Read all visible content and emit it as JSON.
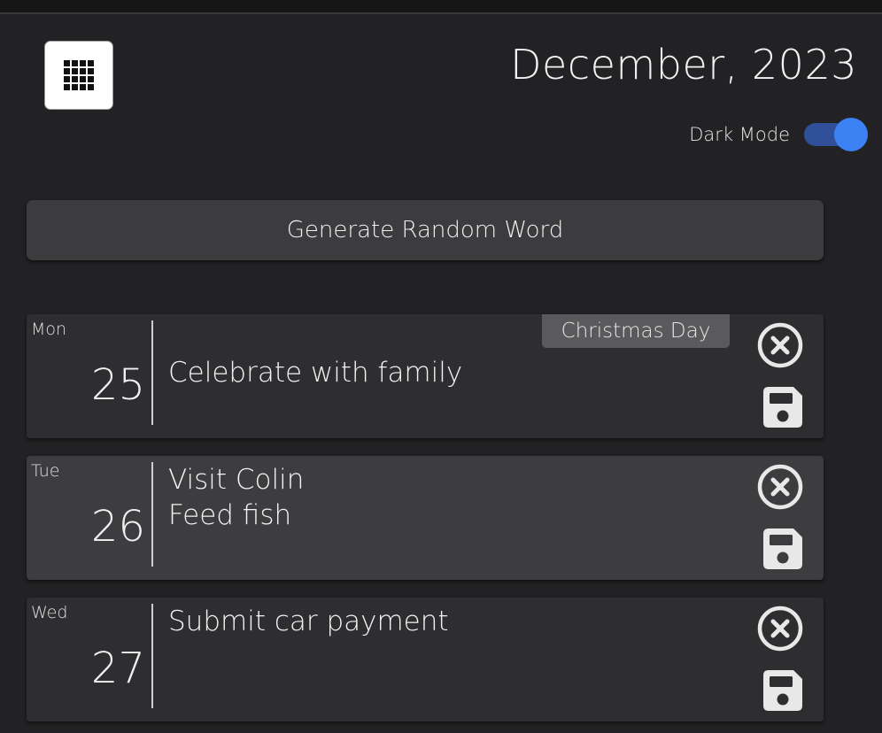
{
  "header": {
    "menu_icon": "grid-icon",
    "month_title": "December, 2023",
    "dark_mode_label": "Dark Mode",
    "dark_mode_on": true,
    "toggle_color": "#3d82f5"
  },
  "generate_button_label": "Generate Random Word",
  "days": [
    {
      "weekday": "Mon",
      "day": "25",
      "holiday": "Christmas Day",
      "tasks": [
        "Celebrate with family"
      ]
    },
    {
      "weekday": "Tue",
      "day": "26",
      "holiday": "",
      "tasks": [
        "Visit Colin",
        "Feed fish"
      ]
    },
    {
      "weekday": "Wed",
      "day": "27",
      "holiday": "",
      "tasks": [
        "Submit car payment"
      ]
    }
  ],
  "row_icons": {
    "delete": "circle-x-icon",
    "save": "floppy-disk-icon"
  }
}
